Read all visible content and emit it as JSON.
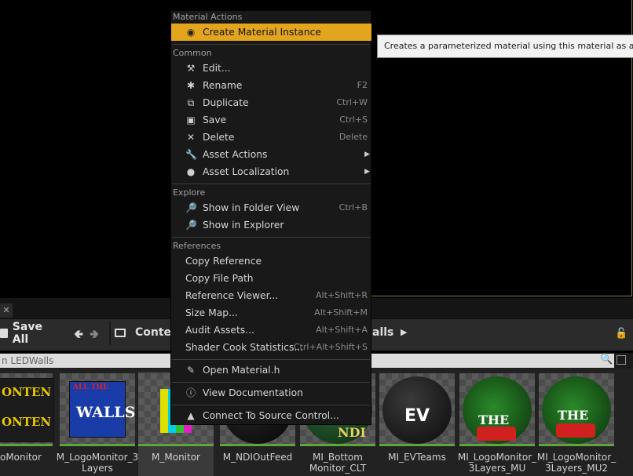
{
  "menu": {
    "sections": {
      "material_actions": "Material Actions",
      "common": "Common",
      "explore": "Explore",
      "references": "References"
    },
    "items": {
      "create_material_instance": "Create Material Instance",
      "edit": "Edit...",
      "rename": {
        "label": "Rename",
        "shortcut": "F2"
      },
      "duplicate": {
        "label": "Duplicate",
        "shortcut": "Ctrl+W"
      },
      "save": {
        "label": "Save",
        "shortcut": "Ctrl+S"
      },
      "delete": {
        "label": "Delete",
        "shortcut": "Delete"
      },
      "asset_actions": "Asset Actions",
      "asset_localization": "Asset Localization",
      "show_in_folder_view": {
        "label": "Show in Folder View",
        "shortcut": "Ctrl+B"
      },
      "show_in_explorer": "Show in Explorer",
      "copy_reference": "Copy Reference",
      "copy_file_path": "Copy File Path",
      "reference_viewer": {
        "label": "Reference Viewer...",
        "shortcut": "Alt+Shift+R"
      },
      "size_map": {
        "label": "Size Map...",
        "shortcut": "Alt+Shift+M"
      },
      "audit_assets": {
        "label": "Audit Assets...",
        "shortcut": "Alt+Shift+A"
      },
      "shader_cook_statistics": {
        "label": "Shader Cook Statistics...",
        "shortcut": "Ctrl+Alt+Shift+S"
      },
      "open_material_h": "Open Material.h",
      "view_documentation": "View Documentation",
      "connect_source_control": "Connect To Source Control..."
    }
  },
  "tooltip": "Creates a parameterized material using this material as a base",
  "toolbar": {
    "save_all": "Save All",
    "crumb_content": "Conter",
    "crumb_ledwalls": "alls"
  },
  "search": {
    "placeholder": "n LEDWalls"
  },
  "tab_close": "✕",
  "assets": [
    {
      "name": "ogoMonitor"
    },
    {
      "name": "M_LogoMonitor_3\nLayers"
    },
    {
      "name": "M_Monitor"
    },
    {
      "name": "M_NDIOutFeed"
    },
    {
      "name": "MI_Bottom\nMonitor_CLT"
    },
    {
      "name": "MI_EVTeams"
    },
    {
      "name": "MI_LogoMonitor_\n3Layers_MU"
    },
    {
      "name": "MI_LogoMonitor_\n3Layers_MU2"
    }
  ],
  "colors": {
    "highlight": "#e3a51d",
    "menu_bg": "#191919",
    "asset_bar": "#5ea53a"
  }
}
